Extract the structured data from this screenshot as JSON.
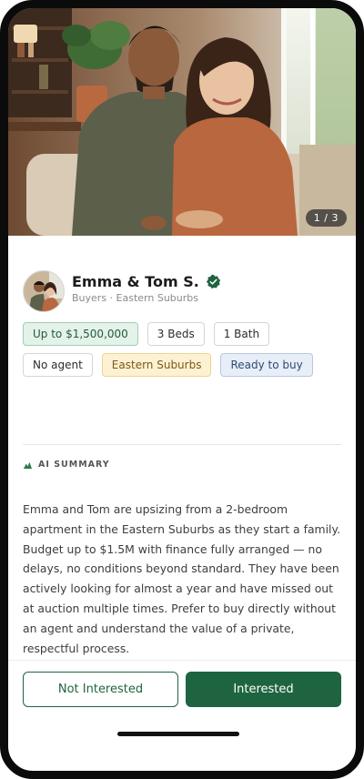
{
  "photo": {
    "counter": "1 / 3",
    "icon": "couple-photo"
  },
  "profile": {
    "name": "Emma & Tom S.",
    "subtitle": "Buyers · Eastern Suburbs",
    "verified_icon": "verified-check-icon",
    "accent": "#1f6440"
  },
  "tags": [
    {
      "label": "Up to $1,500,000",
      "style": "green"
    },
    {
      "label": "3 Beds",
      "style": "plain"
    },
    {
      "label": "1 Bath",
      "style": "plain"
    },
    {
      "label": "No agent",
      "style": "plain"
    },
    {
      "label": "Eastern Suburbs",
      "style": "yellow"
    },
    {
      "label": "Ready to buy",
      "style": "blue"
    }
  ],
  "ai_summary": {
    "label": "AI SUMMARY",
    "icon": "ai-sparkle-icon",
    "text": "Emma and Tom are upsizing from a 2-bedroom apartment in the Eastern Suburbs as they start a family. Budget up to $1.5M with finance fully arranged — no delays, no conditions beyond standard. They have been actively looking for almost a year and have missed out at auction multiple times. Prefer to buy directly without an agent and understand the value of a private, respectful process."
  },
  "actions": {
    "not_interested": "Not Interested",
    "interested": "Interested"
  }
}
